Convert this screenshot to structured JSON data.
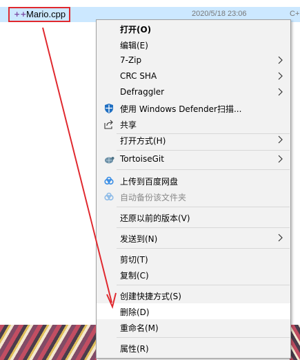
{
  "file": {
    "name": "Mario.cpp",
    "date": "2020/5/18 23:06",
    "extra": "C+"
  },
  "menu": {
    "open": "打开(O)",
    "edit": "编辑(E)",
    "zip": "7-Zip",
    "crc": "CRC SHA",
    "defraggler": "Defraggler",
    "defender": "使用 Windows Defender扫描...",
    "share": "共享",
    "open_with": "打开方式(H)",
    "tortoise": "TortoiseGit",
    "baidu_upload": "上传到百度网盘",
    "baidu_backup": "自动备份该文件夹",
    "restore": "还原以前的版本(V)",
    "send_to": "发送到(N)",
    "cut": "剪切(T)",
    "copy": "复制(C)",
    "shortcut": "创建快捷方式(S)",
    "delete": "删除(D)",
    "rename": "重命名(M)",
    "properties": "属性(R)"
  },
  "colors": {
    "selection": "#cce8ff",
    "annotation": "#e0282e",
    "menu_bg": "#f2f2f2"
  }
}
